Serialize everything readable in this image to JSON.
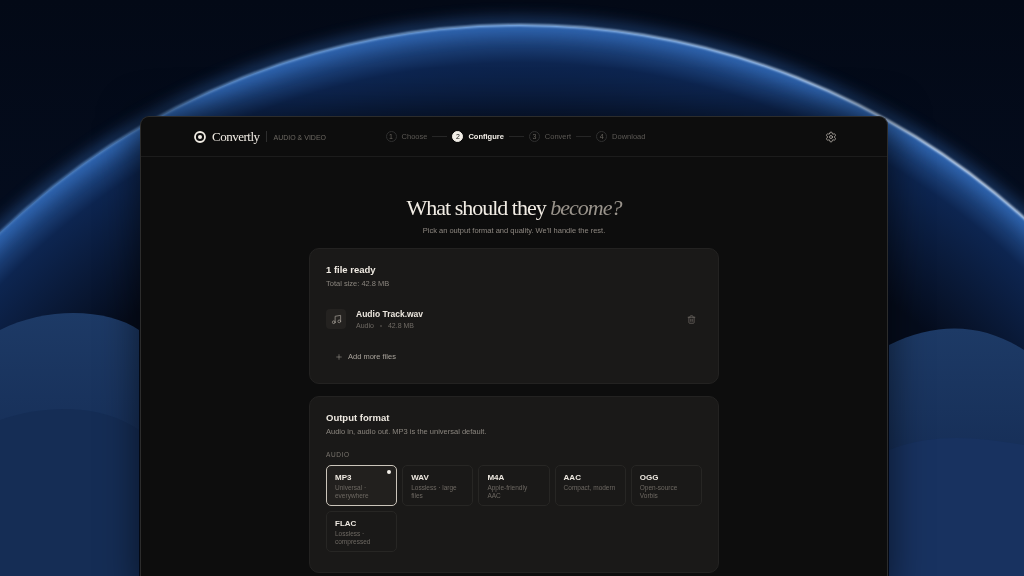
{
  "header": {
    "logo": "Convertly",
    "tagline": "AUDIO & VIDEO",
    "steps": [
      {
        "number": "1",
        "label": "Choose",
        "selected": false
      },
      {
        "number": "2",
        "label": "Configure",
        "selected": true
      },
      {
        "number": "3",
        "label": "Convert",
        "selected": false
      },
      {
        "number": "4",
        "label": "Download",
        "selected": false
      }
    ]
  },
  "hero": {
    "title": "What should they *become?*",
    "subtitle": "Pick an output format and quality. We'll handle the rest."
  },
  "files_card": {
    "title": "1 file ready",
    "total_size": "Total size: 42.8 MB",
    "files": [
      {
        "name": "Audio Track.wav",
        "type": "Audio",
        "size": "42.8 MB"
      }
    ],
    "add_button": "Add more files"
  },
  "format_card": {
    "title": "Output format",
    "description": "Audio in, audio out. MP3 is the universal default.",
    "group_label": "AUDIO",
    "formats": [
      {
        "name": "MP3",
        "description": "Universal · everywhere",
        "selected": true
      },
      {
        "name": "WAV",
        "description": "Lossless · large files",
        "selected": false
      },
      {
        "name": "M4A",
        "description": "Apple-friendly AAC",
        "selected": false
      },
      {
        "name": "AAC",
        "description": "Compact, modern",
        "selected": false
      },
      {
        "name": "OGG",
        "description": "Open-source Vorbis",
        "selected": false
      },
      {
        "name": "FLAC",
        "description": "Lossless · compressed",
        "selected": false
      }
    ]
  }
}
